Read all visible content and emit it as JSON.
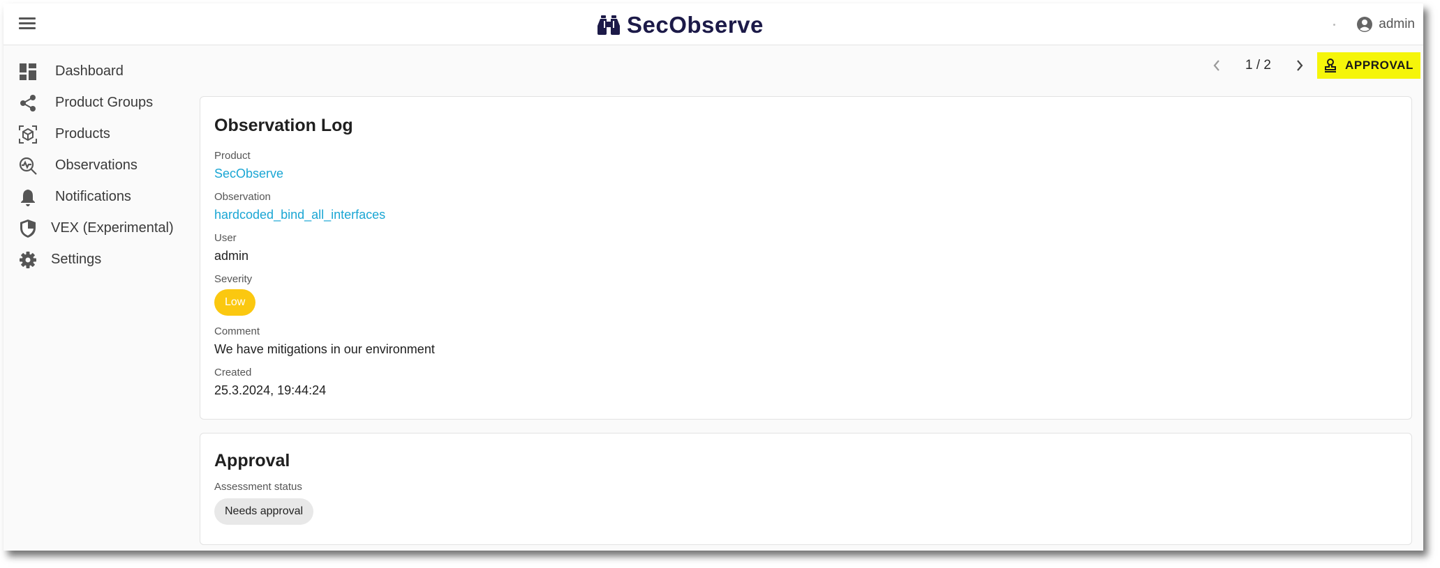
{
  "app": {
    "brand": "SecObserve",
    "brand_color": "#1c1a48"
  },
  "header": {
    "user_name": "admin"
  },
  "sidebar": {
    "items": [
      {
        "label": "Dashboard",
        "icon": "dashboard-icon"
      },
      {
        "label": "Product Groups",
        "icon": "share-icon"
      },
      {
        "label": "Products",
        "icon": "cube-scan-icon"
      },
      {
        "label": "Observations",
        "icon": "search-pulse-icon"
      },
      {
        "label": "Notifications",
        "icon": "bell-icon"
      },
      {
        "label": "VEX (Experimental)",
        "icon": "shield-icon"
      },
      {
        "label": "Settings",
        "icon": "gear-icon"
      }
    ]
  },
  "toolbar": {
    "pager": "1 / 2",
    "approval_label": "APPROVAL",
    "approval_color": "#f5f50a"
  },
  "observation_log": {
    "title": "Observation Log",
    "product_label": "Product",
    "product_value": "SecObserve",
    "observation_label": "Observation",
    "observation_value": "hardcoded_bind_all_interfaces",
    "user_label": "User",
    "user_value": "admin",
    "severity_label": "Severity",
    "severity_value": "Low",
    "severity_color": "#fbc810",
    "comment_label": "Comment",
    "comment_value": "We have mitigations in our environment",
    "created_label": "Created",
    "created_value": "25.3.2024, 19:44:24",
    "link_color": "#1aa6d4"
  },
  "approval": {
    "title": "Approval",
    "status_label": "Assessment status",
    "status_value": "Needs approval"
  }
}
